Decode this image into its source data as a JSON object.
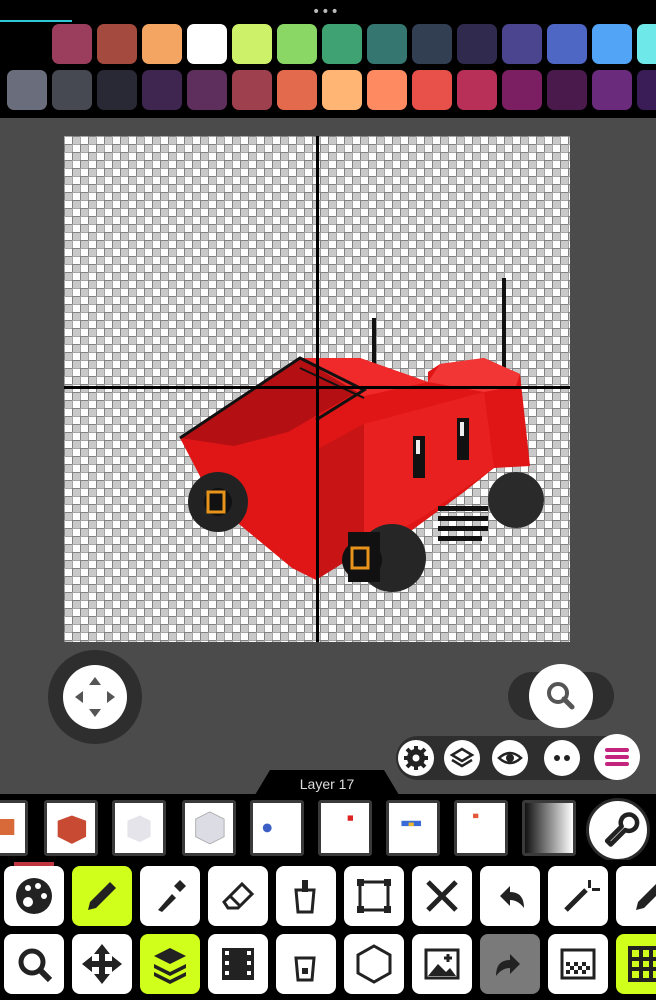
{
  "palette": {
    "row1": [
      "#000000",
      "#9b3e5d",
      "#a44a3f",
      "#f3a561",
      "#ffffff",
      "#cdf26a",
      "#8bd765",
      "#3ea273",
      "#357770",
      "#323e51",
      "#2f2a4e",
      "#4b4590",
      "#4e66c4",
      "#52a4f7",
      "#6ee8e8"
    ],
    "row2": [
      "#6a6d7c",
      "#464852",
      "#292935",
      "#3f2650",
      "#5e2e5d",
      "#9e404e",
      "#e46a4e",
      "#ffb574",
      "#fd8a60",
      "#e8504a",
      "#b82f57",
      "#7c1f62",
      "#4a1a4c",
      "#6a2b7c",
      "#3a1d56"
    ]
  },
  "layer": {
    "name": "Layer 17"
  },
  "layers": [
    {
      "name": "layer-1"
    },
    {
      "name": "layer-2"
    },
    {
      "name": "layer-3"
    },
    {
      "name": "layer-4"
    },
    {
      "name": "layer-5"
    },
    {
      "name": "layer-6"
    },
    {
      "name": "layer-7"
    },
    {
      "name": "layer-8"
    },
    {
      "name": "layer-9"
    }
  ],
  "tools_row1": [
    "palette-icon",
    "pencil-icon",
    "eyedropper-icon",
    "eraser-icon",
    "fill-bucket-icon",
    "select-rect-icon",
    "tools-icon",
    "undo-icon",
    "magic-wand-icon",
    "pen-icon"
  ],
  "tools_row2": [
    "zoom-icon",
    "move-icon",
    "layers-icon",
    "film-icon",
    "fill-icon",
    "hexagon-icon",
    "add-image-icon",
    "redo-icon",
    "checker-icon",
    "grid-icon"
  ],
  "colors": {
    "accent": "#cfff1a",
    "canvas_guide": "#000000",
    "truck": "#e21b1b"
  }
}
